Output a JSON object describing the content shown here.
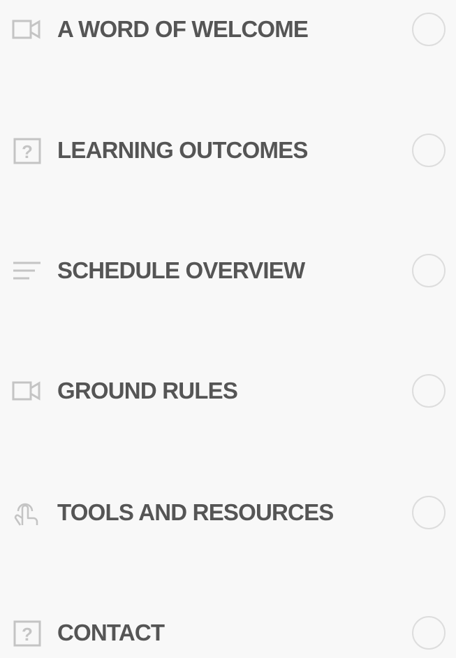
{
  "lessons": [
    {
      "title": "A WORD OF WELCOME",
      "icon": "video-icon"
    },
    {
      "title": "LEARNING OUTCOMES",
      "icon": "quiz-icon"
    },
    {
      "title": "SCHEDULE OVERVIEW",
      "icon": "text-lines-icon"
    },
    {
      "title": "GROUND RULES",
      "icon": "video-icon"
    },
    {
      "title": "TOOLS AND RESOURCES",
      "icon": "touch-icon"
    },
    {
      "title": "CONTACT",
      "icon": "quiz-icon"
    }
  ],
  "colors": {
    "background": "#f8f8f8",
    "title_text": "#555555",
    "icon": "#c4c4c4",
    "status_circle": "#dddddd"
  }
}
